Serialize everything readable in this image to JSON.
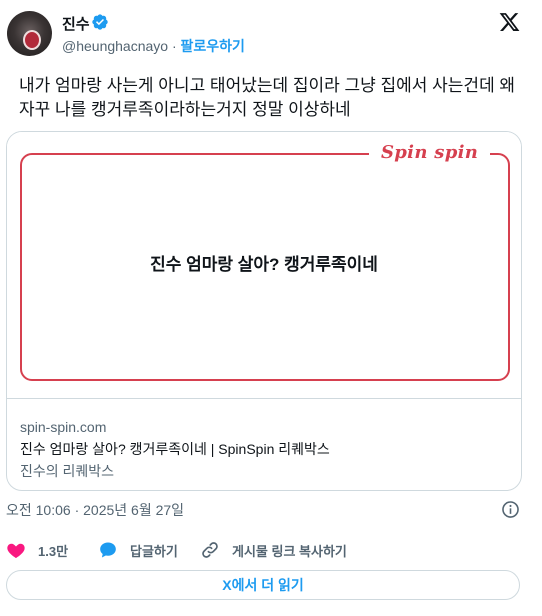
{
  "user": {
    "name": "진수",
    "handle": "@heunghacnayo",
    "separator": "·",
    "follow_label": "팔로우하기"
  },
  "tweet": {
    "text": "내가 엄마랑 사는게 아니고 태어났는데 집이라 그냥 집에서 사는건데 왜 자꾸 나를 캥거루족이라하는거지 정말 이상하네"
  },
  "card": {
    "brand": "Spin spin",
    "headline": "진수 엄마랑 살아? 캥거루족이네",
    "domain": "spin-spin.com",
    "title": "진수 엄마랑 살아? 캥거루족이네 | SpinSpin 리퀘박스",
    "description": "진수의 리퀘박스"
  },
  "timestamp": "오전 10:06 · 2025년 6월 27일",
  "actions": {
    "likes": "1.3만",
    "reply_label": "답글하기",
    "copy_link_label": "게시물 링크 복사하기"
  },
  "read_more_label": "X에서 더 읽기",
  "colors": {
    "accent_blue": "#1d9bf0",
    "card_red": "#d6404f",
    "like_pink": "#f91880"
  },
  "icons": [
    "verified-badge-icon",
    "x-logo-icon",
    "info-icon",
    "heart-icon",
    "reply-bubble-icon",
    "link-icon"
  ]
}
